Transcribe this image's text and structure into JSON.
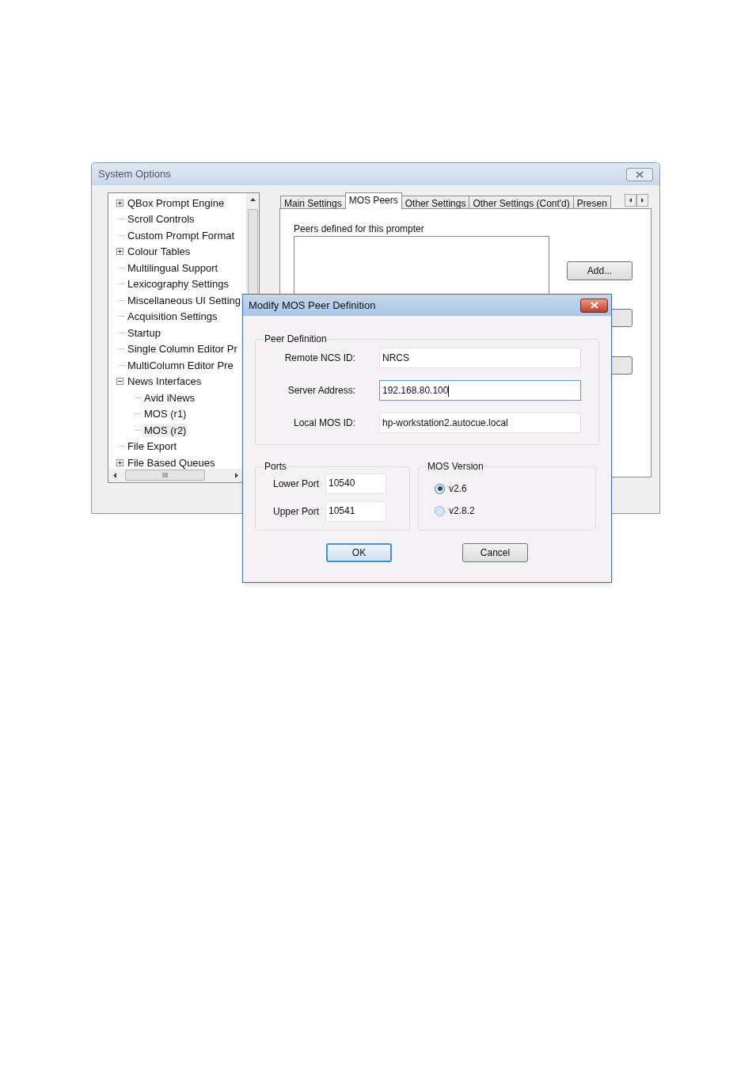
{
  "main_window": {
    "title": "System Options",
    "tree": [
      {
        "label": "QBox Prompt Engine",
        "expanded": false,
        "selected": false
      },
      {
        "label": "Scroll Controls",
        "selected": false
      },
      {
        "label": "Custom Prompt Format",
        "selected": false
      },
      {
        "label": "Colour Tables",
        "expanded": false,
        "selected": false
      },
      {
        "label": "Multilingual Support",
        "selected": false
      },
      {
        "label": "Lexicography Settings",
        "selected": false
      },
      {
        "label": "Miscellaneous UI Setting",
        "selected": false
      },
      {
        "label": "Acquisition Settings",
        "selected": false
      },
      {
        "label": "Startup",
        "selected": false
      },
      {
        "label": "Single Column Editor Pr",
        "selected": false
      },
      {
        "label": "MultiColumn Editor Pre",
        "selected": false
      },
      {
        "label": "News Interfaces",
        "expanded": true,
        "selected": false,
        "children": [
          {
            "label": "Avid iNews",
            "selected": false
          },
          {
            "label": "MOS (r1)",
            "selected": false
          },
          {
            "label": "MOS (r2)",
            "selected": true
          }
        ]
      },
      {
        "label": "File Export",
        "selected": false
      },
      {
        "label": "File Based Queues",
        "expanded": false,
        "selected": false
      }
    ],
    "tabs": [
      {
        "label": "Main Settings",
        "selected": false
      },
      {
        "label": "MOS Peers",
        "selected": true
      },
      {
        "label": "Other Settings",
        "selected": false
      },
      {
        "label": "Other Settings (Cont'd)",
        "selected": false
      },
      {
        "label": "Presen",
        "selected": false
      }
    ],
    "peers_label": "Peers defined for this prompter",
    "add_button": "Add..."
  },
  "dialog": {
    "title": "Modify MOS Peer Definition",
    "peer_group": {
      "title": "Peer Definition",
      "fields": [
        {
          "label": "Remote NCS ID:",
          "value": "NRCS",
          "focused": false
        },
        {
          "label": "Server Address:",
          "value": "192.168.80.100",
          "focused": true
        },
        {
          "label": "Local MOS ID:",
          "value": "hp-workstation2.autocue.local",
          "focused": false
        }
      ]
    },
    "ports_group": {
      "title": "Ports",
      "fields": [
        {
          "label": "Lower Port",
          "value": "10540"
        },
        {
          "label": "Upper Port",
          "value": "10541"
        }
      ]
    },
    "version_group": {
      "title": "MOS Version",
      "options": [
        {
          "label": "v2.6",
          "selected": true
        },
        {
          "label": "v2.8.2",
          "selected": false
        }
      ]
    },
    "buttons": [
      {
        "label": "OK",
        "default": true
      },
      {
        "label": "Cancel",
        "default": false
      }
    ]
  }
}
